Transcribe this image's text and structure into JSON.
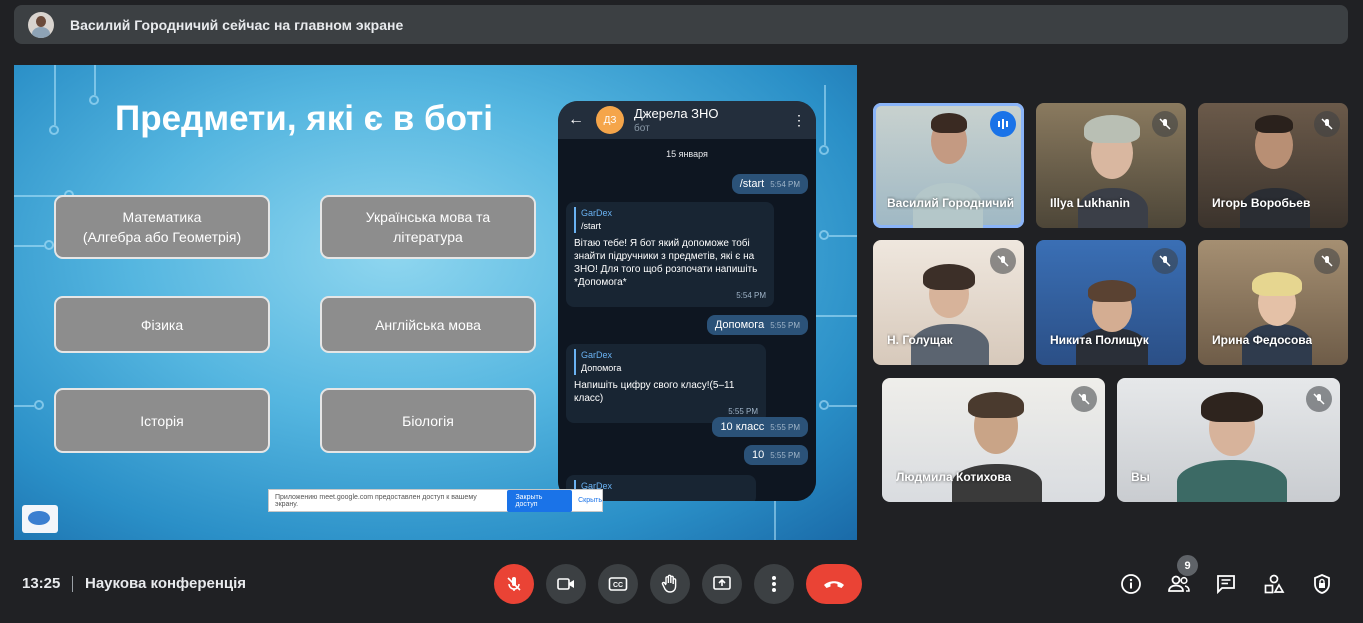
{
  "banner": {
    "text": "Василий Городничий сейчас на главном экране"
  },
  "slide": {
    "title": "Предмети, які є в боті",
    "subjects": [
      {
        "line1": "Математика",
        "line2": "(Алгебра або Геометрія)"
      },
      {
        "line1": "Українська мова та",
        "line2": "література"
      },
      {
        "line1": "Фізика",
        "line2": ""
      },
      {
        "line1": "Англійська мова",
        "line2": ""
      },
      {
        "line1": "Історія",
        "line2": ""
      },
      {
        "line1": "Біологія",
        "line2": ""
      }
    ],
    "share_bar": {
      "text": "Приложению meet.google.com предоставлен доступ к вашему экрану.",
      "stop_button": "Закрыть доступ",
      "hide_button": "Скрыть"
    }
  },
  "phone": {
    "chat_title": "Джерела ЗНО",
    "chat_subtitle": "бот",
    "avatar_initials": "ДЗ",
    "date": "15 января",
    "messages": [
      {
        "text": "/start",
        "time": "5:54 PM"
      },
      {
        "quote_name": "GarDex",
        "quote_text": "/start",
        "text": "Вітаю тебе! Я бот який допоможе тобі знайти підручники з предметів, які є на ЗНО! Для того щоб розпочати напишіть *Допомога*",
        "time": "5:54 PM"
      },
      {
        "text": "Допомога",
        "time": "5:55 PM"
      },
      {
        "quote_name": "GarDex",
        "quote_text": "Допомога",
        "text": "Напишіть цифру свого класу!(5–11 класс)",
        "time": "5:55 PM"
      },
      {
        "text": "10 класс",
        "time": "5:55 PM"
      },
      {
        "text": "10",
        "time": "5:55 PM"
      },
      {
        "quote_name": "GarDex"
      }
    ]
  },
  "participants": [
    {
      "name": "Василий Городничий",
      "mic": "speaking-icon"
    },
    {
      "name": "Illya Lukhanin",
      "mic": "mic-off-icon"
    },
    {
      "name": "Игорь Воробьев",
      "mic": "mic-off-icon"
    },
    {
      "name": "Н. Голущак",
      "mic": "mic-off-icon"
    },
    {
      "name": "Никита Полищук",
      "mic": "mic-off-icon"
    },
    {
      "name": "Ирина Федосова",
      "mic": "mic-off-icon"
    },
    {
      "name": "Людмила Котихова",
      "mic": "mic-off-icon"
    },
    {
      "name": "Вы",
      "mic": "mic-off-icon"
    }
  ],
  "bottom": {
    "time": "13:25",
    "meeting_name": "Наукова конференція",
    "participant_count": "9"
  },
  "colors": {
    "accent": "#8ab4f8",
    "danger": "#ea4335",
    "bar": "#3c4043"
  }
}
